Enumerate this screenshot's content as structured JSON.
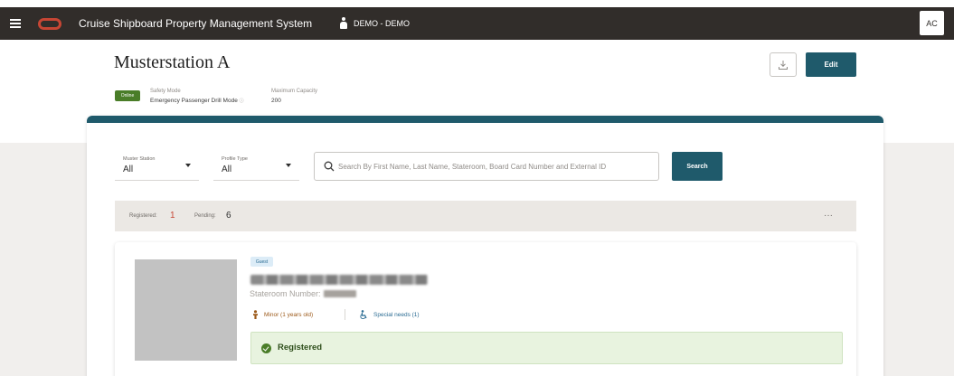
{
  "app": {
    "title": "Cruise Shipboard Property Management System",
    "user": "DEMO - DEMO",
    "avatar_initials": "AC",
    "brand_color": "#c74634",
    "topbar_color": "#312d2a"
  },
  "header": {
    "page_title": "Musterstation A",
    "edit_label": "Edit",
    "download_icon": "download-icon",
    "status": "Online",
    "safety_mode_label": "Safety Mode",
    "safety_mode_value": "Emergency Passenger Drill Mode",
    "max_capacity_label": "Maximum Capacity",
    "max_capacity_value": "200"
  },
  "filters": {
    "muster_station": {
      "label": "Muster Station",
      "value": "All"
    },
    "profile_type": {
      "label": "Profile Type",
      "value": "All"
    },
    "search_placeholder": "Search By First Name, Last Name, Stateroom, Board Card Number and External ID",
    "search_label": "Search",
    "accent_color": "#1f5a6b"
  },
  "summary": {
    "registered_label": "Registered:",
    "registered_count": "1",
    "pending_label": "Pending:",
    "pending_count": "6",
    "more_label": "···"
  },
  "guest": {
    "tag": "Guest",
    "stateroom_label": "Stateroom Number:",
    "minor_label": "Minor (1 years old)",
    "special_needs_label": "Special needs (1)",
    "status_label": "Registered",
    "status_color": "#4a7d28"
  }
}
